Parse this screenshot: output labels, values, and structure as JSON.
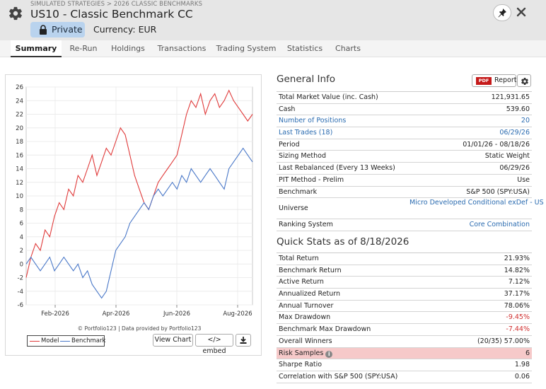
{
  "header": {
    "breadcrumb": "SIMULATED STRATEGIES > 2026 CLASSIC BENCHMARKS",
    "title": "US10 - Classic Benchmark CC",
    "visibility": "Private",
    "currency": "Currency: EUR"
  },
  "tabs": [
    {
      "label": "Summary",
      "active": true
    },
    {
      "label": "Re-Run"
    },
    {
      "label": "Holdings"
    },
    {
      "label": "Transactions"
    },
    {
      "label": "Trading System"
    },
    {
      "label": "Statistics"
    },
    {
      "label": "Charts"
    }
  ],
  "chart": {
    "credit": "© Portfolio123 | Data provided by Portfolio123",
    "view_chart": "View Chart",
    "embed": "</> embed",
    "download_icon": "download-icon"
  },
  "chart_data": {
    "type": "line",
    "x_tick_labels": [
      "Feb-2026",
      "Apr-2026",
      "Jun-2026",
      "Aug-2026"
    ],
    "ylim": [
      -6,
      26
    ],
    "y_ticks": [
      -6,
      -4,
      -2,
      0,
      2,
      4,
      6,
      8,
      10,
      12,
      14,
      16,
      18,
      20,
      22,
      24,
      26
    ],
    "grid": true,
    "legend_position": "bottom-left",
    "series": [
      {
        "name": "Model",
        "color": "#e03b3b",
        "values": [
          -2,
          1,
          3,
          2,
          5,
          4,
          7,
          9,
          8,
          11,
          10,
          13,
          12,
          14,
          16,
          13,
          15,
          17,
          16,
          18,
          20,
          19,
          16,
          13,
          11,
          9,
          8,
          10,
          12,
          13,
          14,
          15,
          16,
          19,
          22,
          24,
          23,
          25,
          22,
          24,
          25,
          23,
          24,
          25.5,
          24,
          23,
          22,
          21,
          22
        ]
      },
      {
        "name": "Benchmark",
        "color": "#4a78c8",
        "values": [
          0,
          1,
          0,
          -1,
          0,
          1,
          -1,
          0,
          1,
          0,
          -1,
          0,
          -2,
          -1,
          -3,
          -4,
          -5,
          -4,
          -1,
          2,
          3,
          4,
          6,
          7,
          8,
          9,
          8,
          10,
          11,
          10,
          11,
          12,
          11,
          13,
          12,
          14,
          13,
          12,
          13,
          14,
          13,
          12,
          11,
          14,
          15,
          16,
          17,
          16,
          15
        ]
      }
    ]
  },
  "general_info": {
    "title": "General Info",
    "report_label": "Report",
    "pdf_label": "PDF",
    "rows": [
      {
        "k": "Total Market Value (inc. Cash)",
        "v": "121,931.65"
      },
      {
        "k": "Cash",
        "v": "539.60"
      },
      {
        "k": "Number of Positions",
        "v": "20",
        "link": true
      },
      {
        "k": "Last Trades (18)",
        "v": "06/29/26",
        "link": true
      },
      {
        "k": "Period",
        "v": "01/01/26 - 08/18/26"
      },
      {
        "k": "Sizing Method",
        "v": "Static Weight"
      },
      {
        "k": "Last Rebalanced (Every 13 Weeks)",
        "v": "06/29/26"
      },
      {
        "k": "PIT Method - Prelim",
        "v": "Use"
      },
      {
        "k": "Benchmark",
        "v": "S&P 500 (SPY:USA)"
      },
      {
        "k": "Universe",
        "v": "Micro Developed Conditional exDef - US",
        "vlink": true,
        "tall": true
      },
      {
        "k": "Ranking System",
        "v": "Core Combination",
        "vlink": true
      }
    ]
  },
  "quick_stats": {
    "title": "Quick Stats as of 8/18/2026",
    "rows": [
      {
        "k": "Total Return",
        "v": "21.93%"
      },
      {
        "k": "Benchmark Return",
        "v": "14.82%"
      },
      {
        "k": "Active Return",
        "v": "7.12%"
      },
      {
        "k": "Annualized Return",
        "v": "37.17%"
      },
      {
        "k": "Annual Turnover",
        "v": "78.06%"
      },
      {
        "k": "Max Drawdown",
        "v": "-9.45%",
        "neg": true
      },
      {
        "k": "Benchmark Max Drawdown",
        "v": "-7.44%",
        "neg": true
      },
      {
        "k": "Overall Winners",
        "v": "(20/35) 57.00%"
      },
      {
        "k": "Risk Samples",
        "v": "6",
        "highlight": true,
        "info": true
      },
      {
        "k": "Sharpe Ratio",
        "v": "1.98"
      },
      {
        "k": "Correlation with S&P 500 (SPY:USA)",
        "v": "0.06"
      }
    ]
  }
}
